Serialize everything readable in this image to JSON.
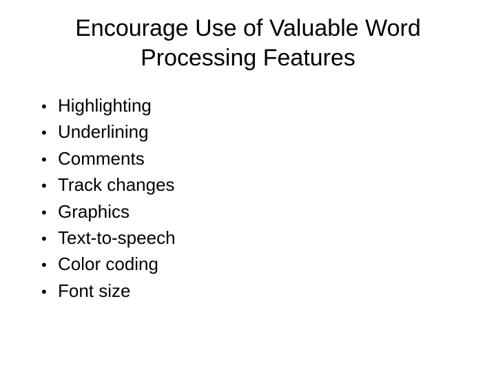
{
  "slide": {
    "title": "Encourage Use of Valuable Word Processing Features",
    "bullets": [
      "Highlighting",
      "Underlining",
      "Comments",
      "Track changes",
      "Graphics",
      "Text-to-speech",
      "Color coding",
      "Font size"
    ]
  }
}
